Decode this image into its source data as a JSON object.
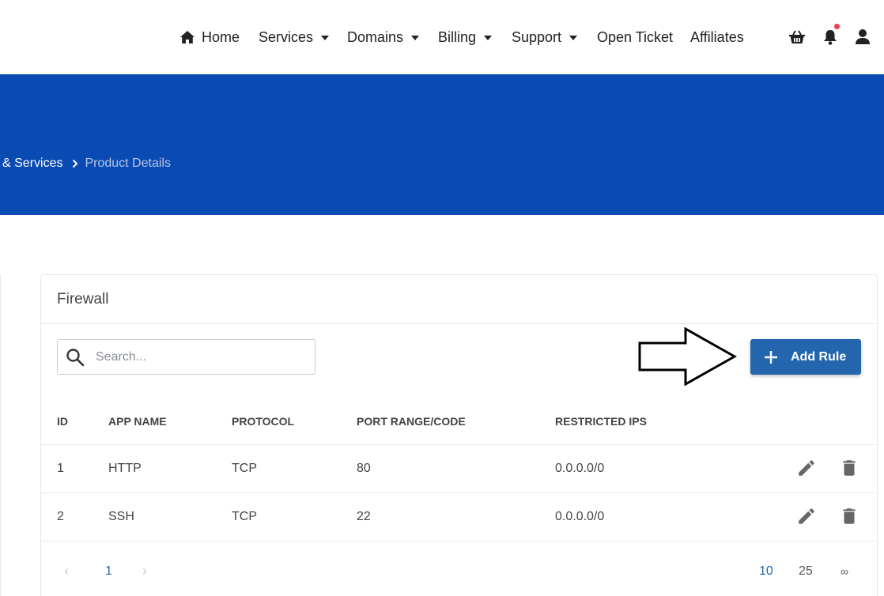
{
  "nav": {
    "items": [
      {
        "label": "Home"
      },
      {
        "label": "Services"
      },
      {
        "label": "Domains"
      },
      {
        "label": "Billing"
      },
      {
        "label": "Support"
      },
      {
        "label": "Open Ticket"
      },
      {
        "label": "Affiliates"
      }
    ],
    "icons": [
      "cart-icon",
      "bell-icon",
      "user-icon"
    ]
  },
  "breadcrumb": {
    "parent": "& Services",
    "current": "Product Details"
  },
  "card": {
    "title": "Firewall",
    "search_placeholder": "Search...",
    "add_button": "Add Rule"
  },
  "table": {
    "headers": [
      "ID",
      "APP NAME",
      "PROTOCOL",
      "PORT RANGE/CODE",
      "RESTRICTED IPS"
    ],
    "rows": [
      {
        "id": "1",
        "app": "HTTP",
        "protocol": "TCP",
        "port": "80",
        "ips": "0.0.0.0/0"
      },
      {
        "id": "2",
        "app": "SSH",
        "protocol": "TCP",
        "port": "22",
        "ips": "0.0.0.0/0"
      }
    ]
  },
  "pagination": {
    "prev": "‹",
    "page": "1",
    "next": "›",
    "sizes": [
      "10",
      "25",
      "∞"
    ],
    "active_size": "10"
  },
  "colors": {
    "hero": "#0a4ab3",
    "primary_button": "#2366ad",
    "notification_dot": "#ef3b55"
  }
}
